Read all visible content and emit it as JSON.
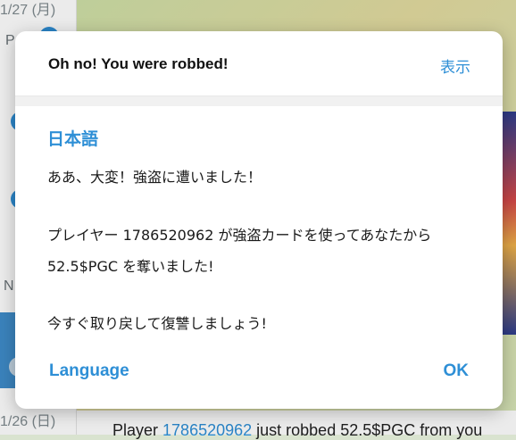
{
  "background": {
    "dates": [
      "1/27 (月)",
      "1/26 (日)"
    ],
    "letters": [
      "P",
      "N"
    ],
    "chat_preview": {
      "prefix": "Player ",
      "player_id": "1786520962",
      "suffix": " just robbed 52.5$PGC from you"
    }
  },
  "dialog": {
    "title": "Oh no! You were robbed!",
    "show_label": "表示",
    "language_name": "日本語",
    "lines": [
      "ああ、大変！強盗に遭いました！",
      "プレイヤー 1786520962 が強盗カードを使ってあなたから",
      "52.5$PGC を奪いました!",
      "今すぐ取り戻して復讐しましょう!"
    ],
    "language_button": "Language",
    "ok_button": "OK"
  },
  "colors": {
    "accent": "#2e8fd6",
    "selected_chat": "#3f8ecb"
  }
}
